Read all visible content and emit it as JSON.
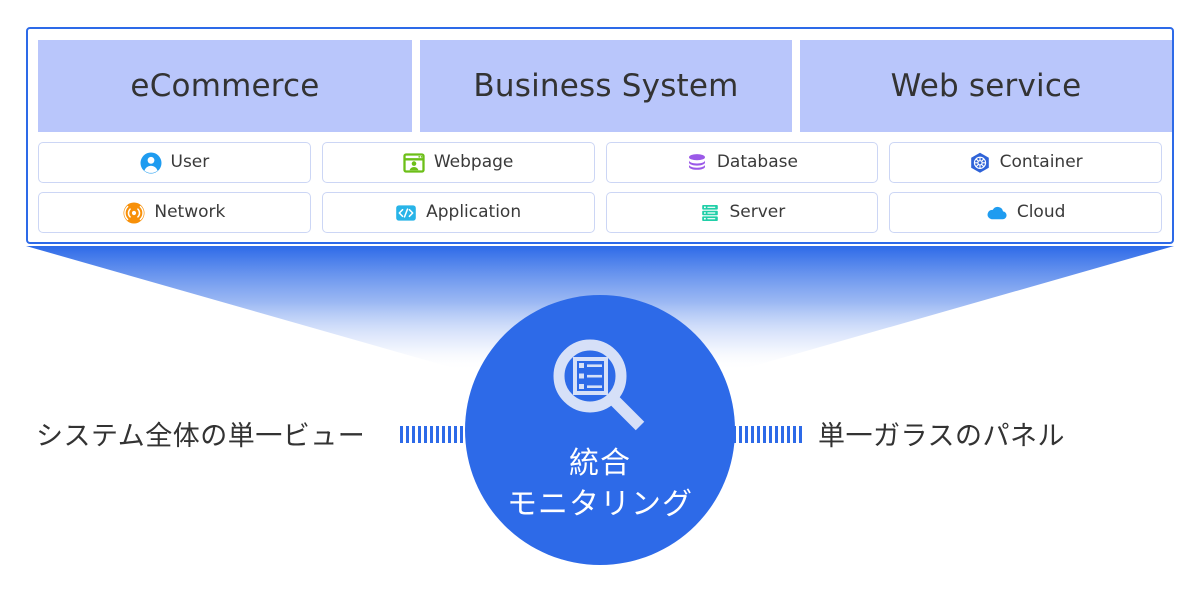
{
  "system_box": {
    "categories": [
      {
        "label": "eCommerce"
      },
      {
        "label": "Business System"
      },
      {
        "label": "Web service"
      }
    ],
    "items_rows": [
      [
        {
          "label": "User",
          "icon": "user-icon",
          "color": "#1f9cf0"
        },
        {
          "label": "Webpage",
          "icon": "webpage-icon",
          "color": "#6cbf18"
        },
        {
          "label": "Database",
          "icon": "database-icon",
          "color": "#9b59e8"
        },
        {
          "label": "Container",
          "icon": "container-icon",
          "color": "#2f63d8"
        }
      ],
      [
        {
          "label": "Network",
          "icon": "network-icon",
          "color": "#f79009"
        },
        {
          "label": "Application",
          "icon": "application-icon",
          "color": "#28b4e8"
        },
        {
          "label": "Server",
          "icon": "server-icon",
          "color": "#21cfa8"
        },
        {
          "label": "Cloud",
          "icon": "cloud-icon",
          "color": "#1f9cf0"
        }
      ]
    ]
  },
  "center": {
    "icon": "magnifying-glass-server-icon",
    "line1": "統合",
    "line2": "モニタリング",
    "background_color": "#2d6ae8"
  },
  "captions": {
    "left": "システム全体の単一ビュー",
    "right": "単一ガラスのパネル"
  },
  "colors": {
    "accent": "#2d6ae8",
    "category_band": "#b9c6fb",
    "card_border": "#ccd6f5",
    "text": "#333333"
  }
}
